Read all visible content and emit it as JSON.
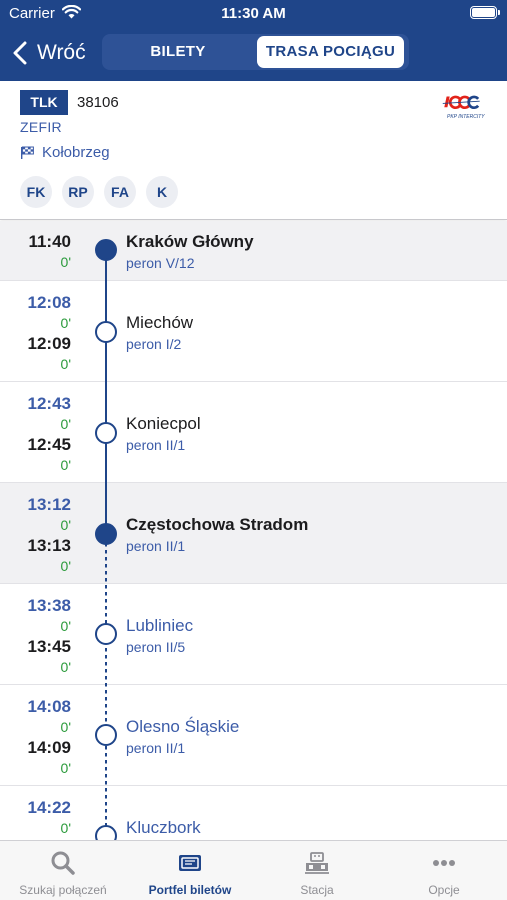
{
  "status": {
    "carrier": "Carrier",
    "time": "11:30 AM"
  },
  "nav": {
    "back_label": "Wróć",
    "tabs": [
      "BILETY",
      "TRASA POCIĄGU"
    ],
    "active_tab": "TRASA POCIĄGU"
  },
  "train": {
    "category": "TLK",
    "number": "38106",
    "name": "ZEFIR",
    "destination": "Kołobrzeg",
    "operator_logo_caption": "PKP INTERCITY",
    "amenities": [
      "FK",
      "RP",
      "FA",
      "K"
    ]
  },
  "stops": [
    {
      "departure": "11:40",
      "dep_delay": "0'",
      "station": "Kraków Główny",
      "platform": "peron V/12",
      "state": "past"
    },
    {
      "arrival": "12:08",
      "arr_delay": "0'",
      "departure": "12:09",
      "dep_delay": "0'",
      "station": "Miechów",
      "platform": "peron I/2",
      "state": "now"
    },
    {
      "arrival": "12:43",
      "arr_delay": "0'",
      "departure": "12:45",
      "dep_delay": "0'",
      "station": "Koniecpol",
      "platform": "peron II/1",
      "state": "now"
    },
    {
      "arrival": "13:12",
      "arr_delay": "0'",
      "departure": "13:13",
      "dep_delay": "0'",
      "station": "Częstochowa Stradom",
      "platform": "peron II/1",
      "state": "past"
    },
    {
      "arrival": "13:38",
      "arr_delay": "0'",
      "departure": "13:45",
      "dep_delay": "0'",
      "station": "Lubliniec",
      "platform": "peron II/5",
      "state": "future"
    },
    {
      "arrival": "14:08",
      "arr_delay": "0'",
      "departure": "14:09",
      "dep_delay": "0'",
      "station": "Olesno Śląskie",
      "platform": "peron II/1",
      "state": "future"
    },
    {
      "arrival": "14:22",
      "arr_delay": "0'",
      "station": "Kluczbork",
      "state": "future"
    }
  ],
  "tabbar": {
    "items": [
      {
        "label": "Szukaj połączeń",
        "icon": "search-icon"
      },
      {
        "label": "Portfel biletów",
        "icon": "ticket-wallet-icon"
      },
      {
        "label": "Stacja",
        "icon": "station-icon"
      },
      {
        "label": "Opcje",
        "icon": "more-icon"
      }
    ],
    "active": "Portfel biletów"
  },
  "colors": {
    "brand": "#1f4589",
    "accent": "#3c5ca8",
    "on_time": "#2a9a3a",
    "highlight_row": "#f1f1f3"
  }
}
